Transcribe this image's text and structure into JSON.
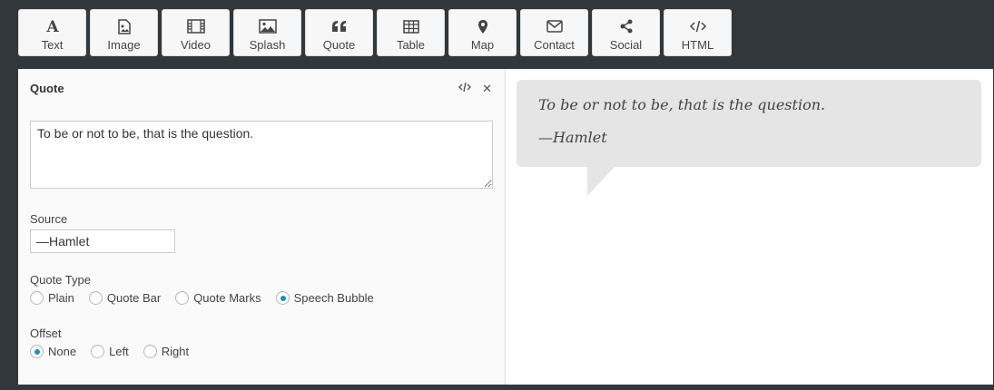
{
  "toolbar": {
    "items": [
      {
        "label": "Text",
        "icon": "text-icon"
      },
      {
        "label": "Image",
        "icon": "image-icon"
      },
      {
        "label": "Video",
        "icon": "video-icon"
      },
      {
        "label": "Splash",
        "icon": "splash-icon"
      },
      {
        "label": "Quote",
        "icon": "quote-icon"
      },
      {
        "label": "Table",
        "icon": "table-icon"
      },
      {
        "label": "Map",
        "icon": "map-pin-icon"
      },
      {
        "label": "Contact",
        "icon": "envelope-icon"
      },
      {
        "label": "Social",
        "icon": "share-icon"
      },
      {
        "label": "HTML",
        "icon": "code-icon"
      }
    ]
  },
  "editor": {
    "title": "Quote",
    "close_glyph": "✕",
    "quote_text": "To be or not to be, that is the question.",
    "source_label": "Source",
    "source_value": "—Hamlet",
    "quote_type": {
      "label": "Quote Type",
      "options": [
        "Plain",
        "Quote Bar",
        "Quote Marks",
        "Speech Bubble"
      ],
      "selected": "Speech Bubble"
    },
    "offset": {
      "label": "Offset",
      "options": [
        "None",
        "Left",
        "Right"
      ],
      "selected": "None"
    }
  },
  "preview": {
    "quote": "To be or not to be, that is the question.",
    "source": "—Hamlet"
  },
  "colors": {
    "background": "#32373c",
    "radio_checked": "#1e8cbe",
    "bubble": "#e5e5e5"
  }
}
